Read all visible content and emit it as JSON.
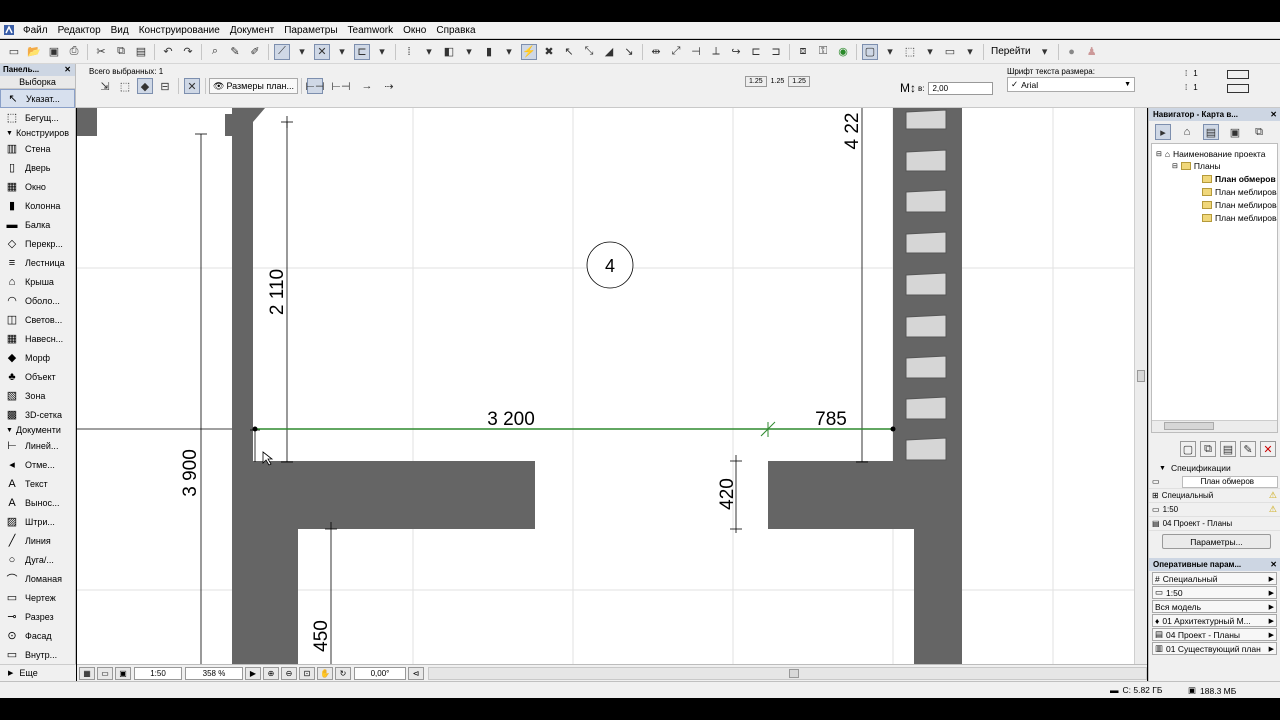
{
  "menu": [
    "Файл",
    "Редактор",
    "Вид",
    "Конструирование",
    "Документ",
    "Параметры",
    "Teamwork",
    "Окно",
    "Справка"
  ],
  "toolbar": {
    "goto_label": "Перейти"
  },
  "infobox": {
    "selected_count": "Всего выбранных: 1",
    "dim_type": "Размеры план...",
    "marker_values": [
      "1.25",
      "1.25",
      "1.25"
    ],
    "height_label": "в:",
    "height_value": "2,00",
    "font_label": "Шрифт текста размера:",
    "font_value": "Arial",
    "pen_values": [
      "1",
      "1"
    ]
  },
  "left_panel": {
    "title": "Панель...",
    "tab": "Выборка",
    "tools_top": [
      "Указат...",
      "Бегущ..."
    ],
    "group_design": "Конструиров",
    "design_tools": [
      "Стена",
      "Дверь",
      "Окно",
      "Колонна",
      "Балка",
      "Перекр...",
      "Лестница",
      "Крыша",
      "Оболо...",
      "Светов...",
      "Навесн...",
      "Морф",
      "Объект",
      "Зона",
      "3D-сетка"
    ],
    "group_doc": "Документи",
    "doc_tools": [
      "Линей...",
      "Отме...",
      "Текст",
      "Выноc...",
      "Штри...",
      "Линия",
      "Дуга/...",
      "Ломаная",
      "Чертеж",
      "Разрез",
      "Фасад",
      "Внутр..."
    ],
    "more": "Еще"
  },
  "drawing": {
    "room_number": "4",
    "dimensions": [
      "2 110",
      "3 200",
      "785",
      "3 900",
      "420",
      "450",
      "4 22"
    ]
  },
  "status": {
    "scale": "1:50",
    "zoom": "358 %",
    "angle": "0,00°"
  },
  "right_panel": {
    "navigator_title": "Навигатор - Карта в...",
    "tree": {
      "project": "Наименование проекта",
      "folder": "Планы",
      "items": [
        "План обмеров",
        "План меблирования",
        "План меблирования",
        "План меблирования"
      ]
    },
    "spec_label": "Спецификации",
    "view_name": "План обмеров",
    "props": [
      "Специальный",
      "1:50",
      "04 Проект - Планы"
    ],
    "params_button": "Параметры...",
    "quick_title": "Оперативные парам...",
    "quick": [
      "Специальный",
      "1:50",
      "Вся модель",
      "01 Архитектурный М...",
      "04 Проект - Планы",
      "01 Существующий план"
    ]
  },
  "bottom": {
    "disk": "С: 5.82 ГБ",
    "memory": "188.3 МБ"
  }
}
